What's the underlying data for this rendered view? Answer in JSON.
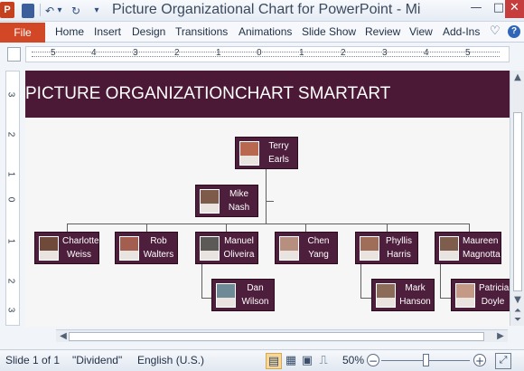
{
  "window": {
    "title": "Picture Organizational Chart for PowerPoint  -  Mi",
    "app_icon_label": "P",
    "quick_access": [
      {
        "name": "save-icon",
        "glyph": ""
      },
      {
        "name": "undo-icon",
        "glyph": "↶"
      },
      {
        "name": "undo-dropdown-icon",
        "glyph": "▾"
      },
      {
        "name": "redo-icon",
        "glyph": "↻"
      },
      {
        "name": "customize-qat-icon",
        "glyph": "▾"
      }
    ],
    "controls": [
      "—",
      "□",
      "✕"
    ]
  },
  "ribbon": {
    "file_label": "File",
    "tabs": [
      "Home",
      "Insert",
      "Design",
      "Transitions",
      "Animations",
      "Slide Show",
      "Review",
      "View",
      "Add-Ins"
    ],
    "heart_icon": "♡",
    "help_icon": "?"
  },
  "ruler": {
    "horizontal": [
      "5",
      "4",
      "3",
      "2",
      "1",
      "0",
      "1",
      "2",
      "3",
      "4",
      "5"
    ],
    "vertical": [
      "3",
      "2",
      "1",
      "0",
      "1",
      "2",
      "3"
    ]
  },
  "slide": {
    "title": "PICTURE ORGANIZATIONCHART SMARTART",
    "colors": {
      "header": "#4b1836",
      "node": "#4e1f3c"
    },
    "people": [
      {
        "id": "terry",
        "name": "Terry\nEarls"
      },
      {
        "id": "mike",
        "name": "Mike\nNash"
      },
      {
        "id": "charlotte",
        "name": "Charlotte\nWeiss"
      },
      {
        "id": "rob",
        "name": "Rob\nWalters"
      },
      {
        "id": "manuel",
        "name": "Manuel\nOliveira"
      },
      {
        "id": "chen",
        "name": "Chen\nYang"
      },
      {
        "id": "phyllis",
        "name": "Phyllis\nHarris"
      },
      {
        "id": "maureen",
        "name": "Maureen\nMagnotta"
      },
      {
        "id": "dan",
        "name": "Dan\nWilson"
      },
      {
        "id": "mark",
        "name": "Mark\nHanson"
      },
      {
        "id": "patricia",
        "name": "Patricia\nDoyle"
      }
    ]
  },
  "statusbar": {
    "slide_info": "Slide 1 of 1",
    "theme": "\"Dividend\"",
    "language": "English (U.S.)",
    "zoom": "50%",
    "zoom_level": 50,
    "minus": "−",
    "plus": "+",
    "fit_icon": "⤢"
  }
}
